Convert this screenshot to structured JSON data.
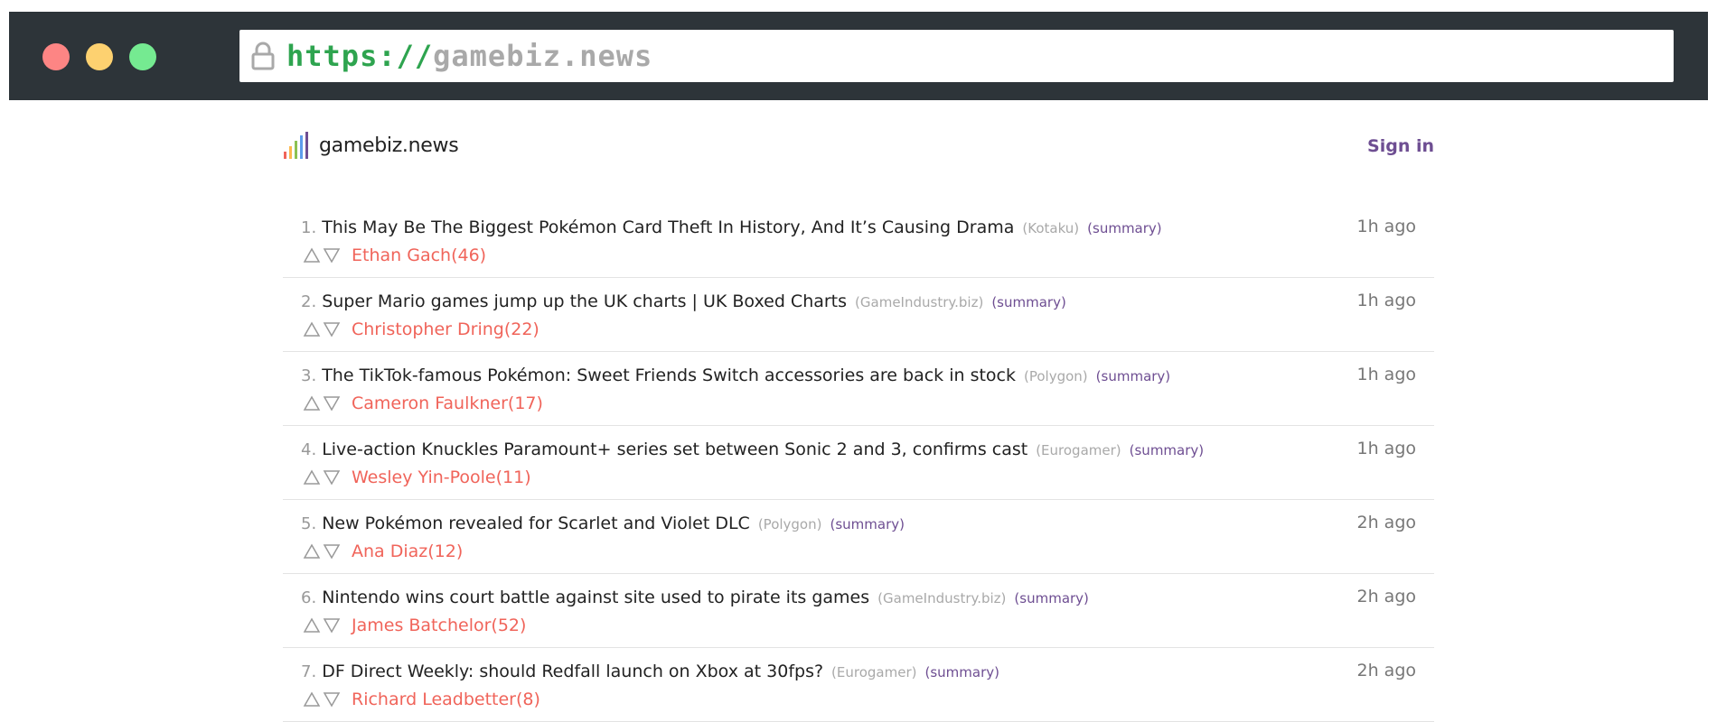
{
  "browser": {
    "url_scheme": "https://",
    "url_host": "gamebiz.news"
  },
  "header": {
    "site_name": "gamebiz.news",
    "sign_in_label": "Sign in"
  },
  "colors": {
    "accent": "#6e4e92",
    "author": "#f0645a",
    "secure": "#2ea44f"
  },
  "stories": [
    {
      "rank": "1.",
      "title": "This May Be The Biggest Pokémon Card Theft In History, And It’s Causing Drama",
      "source": "(Kotaku)",
      "summary": "(summary)",
      "author": "Ethan Gach(46)",
      "time": "1h ago"
    },
    {
      "rank": "2.",
      "title": "Super Mario games jump up the UK charts | UK Boxed Charts",
      "source": "(GameIndustry.biz)",
      "summary": "(summary)",
      "author": "Christopher Dring(22)",
      "time": "1h ago"
    },
    {
      "rank": "3.",
      "title": "The TikTok-famous Pokémon: Sweet Friends Switch accessories are back in stock",
      "source": "(Polygon)",
      "summary": "(summary)",
      "author": "Cameron Faulkner(17)",
      "time": "1h ago"
    },
    {
      "rank": "4.",
      "title": "Live-action Knuckles Paramount+ series set between Sonic 2 and 3, confirms cast",
      "source": "(Eurogamer)",
      "summary": "(summary)",
      "author": "Wesley Yin-Poole(11)",
      "time": "1h ago"
    },
    {
      "rank": "5.",
      "title": "New Pokémon revealed for Scarlet and Violet DLC",
      "source": "(Polygon)",
      "summary": "(summary)",
      "author": "Ana Diaz(12)",
      "time": "2h ago"
    },
    {
      "rank": "6.",
      "title": "Nintendo wins court battle against site used to pirate its games",
      "source": "(GameIndustry.biz)",
      "summary": "(summary)",
      "author": "James Batchelor(52)",
      "time": "2h ago"
    },
    {
      "rank": "7.",
      "title": "DF Direct Weekly: should Redfall launch on Xbox at 30fps?",
      "source": "(Eurogamer)",
      "summary": "(summary)",
      "author": "Richard Leadbetter(8)",
      "time": "2h ago"
    }
  ]
}
